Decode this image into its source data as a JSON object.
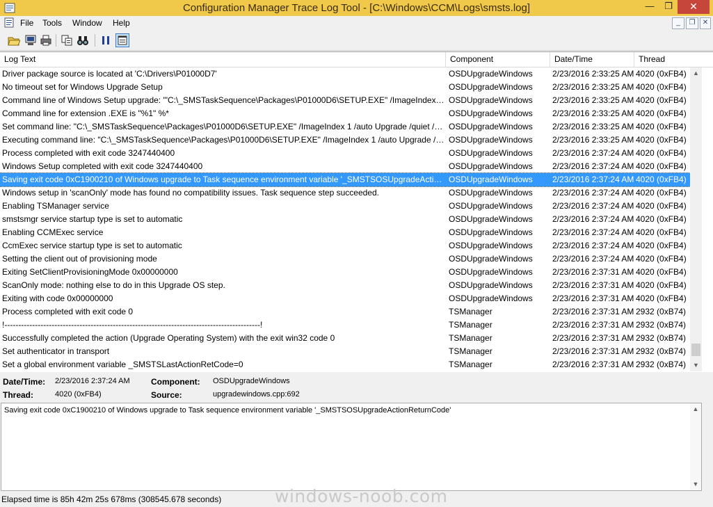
{
  "window": {
    "title": "Configuration Manager Trace Log Tool - [C:\\Windows\\CCM\\Logs\\smsts.log]",
    "min_label": "—",
    "max_label": "❐",
    "close_label": "✕"
  },
  "menu": {
    "items": [
      {
        "label": "File"
      },
      {
        "label": "Tools"
      },
      {
        "label": "Window"
      },
      {
        "label": "Help"
      }
    ]
  },
  "mdi": {
    "min_label": "_",
    "restore_label": "❐",
    "close_label": "✕"
  },
  "columns": {
    "log_text": "Log Text",
    "component": "Component",
    "datetime": "Date/Time",
    "thread": "Thread"
  },
  "rows": [
    {
      "text": "Driver package source is located at 'C:\\Drivers\\P01000D7'",
      "component": "OSDUpgradeWindows",
      "datetime": "2/23/2016 2:33:25 AM",
      "thread": "4020 (0xFB4)"
    },
    {
      "text": "No timeout set for Windows Upgrade Setup",
      "component": "OSDUpgradeWindows",
      "datetime": "2/23/2016 2:33:25 AM",
      "thread": "4020 (0xFB4)"
    },
    {
      "text": "Command line of Windows Setup upgrade: '\"C:\\_SMSTaskSequence\\Packages\\P01000D6\\SETUP.EXE\" /ImageIndex 1 /a...",
      "component": "OSDUpgradeWindows",
      "datetime": "2/23/2016 2:33:25 AM",
      "thread": "4020 (0xFB4)"
    },
    {
      "text": "Command line for extension .EXE is \"%1\" %*",
      "component": "OSDUpgradeWindows",
      "datetime": "2/23/2016 2:33:25 AM",
      "thread": "4020 (0xFB4)"
    },
    {
      "text": "Set command line: \"C:\\_SMSTaskSequence\\Packages\\P01000D6\\SETUP.EXE\" /ImageIndex 1 /auto Upgrade /quiet /nor...",
      "component": "OSDUpgradeWindows",
      "datetime": "2/23/2016 2:33:25 AM",
      "thread": "4020 (0xFB4)"
    },
    {
      "text": "Executing command line: \"C:\\_SMSTaskSequence\\Packages\\P01000D6\\SETUP.EXE\" /ImageIndex 1 /auto Upgrade /quie...",
      "component": "OSDUpgradeWindows",
      "datetime": "2/23/2016 2:33:25 AM",
      "thread": "4020 (0xFB4)"
    },
    {
      "text": "Process completed with exit code 3247440400",
      "component": "OSDUpgradeWindows",
      "datetime": "2/23/2016 2:37:24 AM",
      "thread": "4020 (0xFB4)"
    },
    {
      "text": "Windows Setup completed with exit code 3247440400",
      "component": "OSDUpgradeWindows",
      "datetime": "2/23/2016 2:37:24 AM",
      "thread": "4020 (0xFB4)"
    },
    {
      "text": "Saving exit code 0xC1900210 of Windows upgrade to Task sequence environment variable '_SMSTSOSUpgradeActionRe...",
      "component": "OSDUpgradeWindows",
      "datetime": "2/23/2016 2:37:24 AM",
      "thread": "4020 (0xFB4)"
    },
    {
      "text": "Windows setup in 'scanOnly' mode has found no compatibility issues. Task sequence step succeeded.",
      "component": "OSDUpgradeWindows",
      "datetime": "2/23/2016 2:37:24 AM",
      "thread": "4020 (0xFB4)"
    },
    {
      "text": "Enabling TSManager service",
      "component": "OSDUpgradeWindows",
      "datetime": "2/23/2016 2:37:24 AM",
      "thread": "4020 (0xFB4)"
    },
    {
      "text": "smstsmgr service startup type is set to automatic",
      "component": "OSDUpgradeWindows",
      "datetime": "2/23/2016 2:37:24 AM",
      "thread": "4020 (0xFB4)"
    },
    {
      "text": "Enabling CCMExec service",
      "component": "OSDUpgradeWindows",
      "datetime": "2/23/2016 2:37:24 AM",
      "thread": "4020 (0xFB4)"
    },
    {
      "text": "CcmExec service startup type is set to automatic",
      "component": "OSDUpgradeWindows",
      "datetime": "2/23/2016 2:37:24 AM",
      "thread": "4020 (0xFB4)"
    },
    {
      "text": "Setting the client out of provisioning mode",
      "component": "OSDUpgradeWindows",
      "datetime": "2/23/2016 2:37:24 AM",
      "thread": "4020 (0xFB4)"
    },
    {
      "text": "Exiting SetClientProvisioningMode 0x00000000",
      "component": "OSDUpgradeWindows",
      "datetime": "2/23/2016 2:37:31 AM",
      "thread": "4020 (0xFB4)"
    },
    {
      "text": "ScanOnly mode: nothing else to do in this Upgrade OS step.",
      "component": "OSDUpgradeWindows",
      "datetime": "2/23/2016 2:37:31 AM",
      "thread": "4020 (0xFB4)"
    },
    {
      "text": "Exiting with code 0x00000000",
      "component": "OSDUpgradeWindows",
      "datetime": "2/23/2016 2:37:31 AM",
      "thread": "4020 (0xFB4)"
    },
    {
      "text": "Process completed with exit code 0",
      "component": "TSManager",
      "datetime": "2/23/2016 2:37:31 AM",
      "thread": "2932 (0xB74)"
    },
    {
      "text": "!--------------------------------------------------------------------------------------------!",
      "component": "TSManager",
      "datetime": "2/23/2016 2:37:31 AM",
      "thread": "2932 (0xB74)"
    },
    {
      "text": "Successfully completed the action (Upgrade Operating System) with the exit win32 code 0",
      "component": "TSManager",
      "datetime": "2/23/2016 2:37:31 AM",
      "thread": "2932 (0xB74)"
    },
    {
      "text": "Set authenticator in transport",
      "component": "TSManager",
      "datetime": "2/23/2016 2:37:31 AM",
      "thread": "2932 (0xB74)"
    },
    {
      "text": "Set a global environment variable _SMSTSLastActionRetCode=0",
      "component": "TSManager",
      "datetime": "2/23/2016 2:37:31 AM",
      "thread": "2932 (0xB74)"
    }
  ],
  "selected_row_index": 8,
  "details": {
    "datetime_label": "Date/Time:",
    "datetime_value": "2/23/2016 2:37:24 AM",
    "component_label": "Component:",
    "component_value": "OSDUpgradeWindows",
    "thread_label": "Thread:",
    "thread_value": "4020 (0xFB4)",
    "source_label": "Source:",
    "source_value": "upgradewindows.cpp:692"
  },
  "message": "Saving exit code 0xC1900210 of Windows upgrade to Task sequence environment variable '_SMSTSOSUpgradeActionReturnCode'",
  "status": "Elapsed time is 85h 42m 25s 678ms (308545.678 seconds)",
  "watermark": "windows-noob.com",
  "colors": {
    "titlebar": "#f0c94a",
    "selection": "#3399ff",
    "close": "#c7463c"
  }
}
